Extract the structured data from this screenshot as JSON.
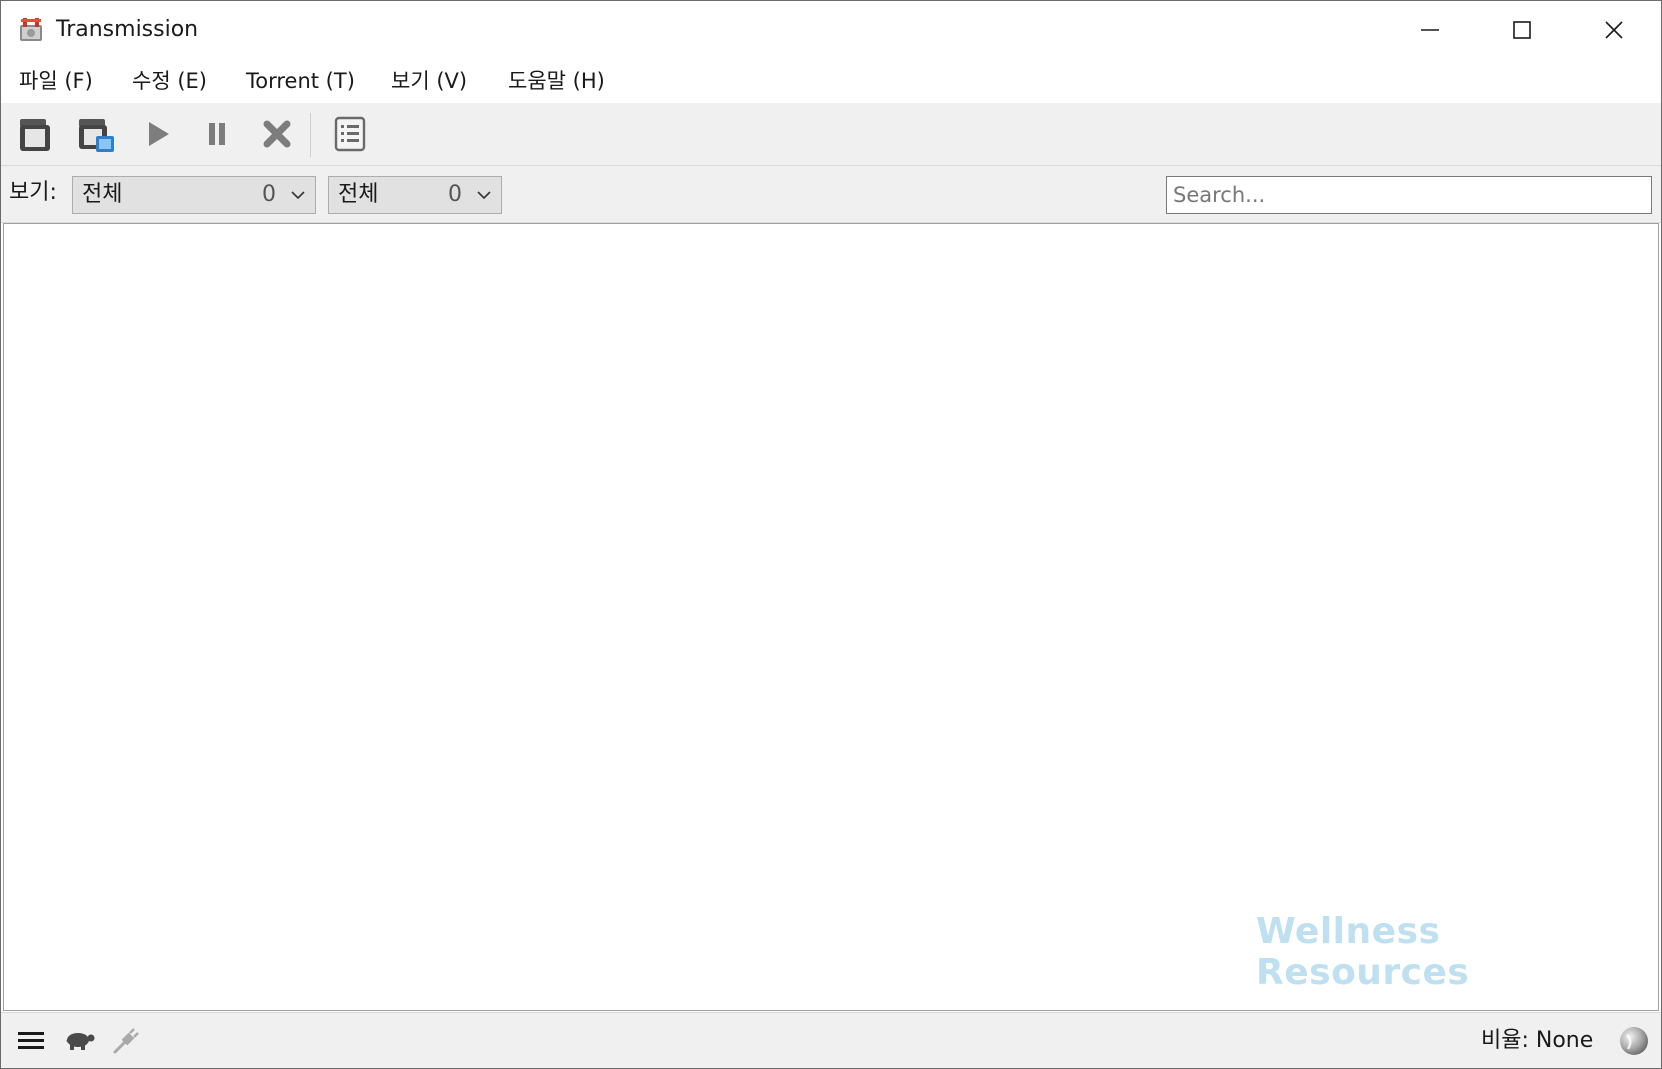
{
  "window": {
    "title": "Transmission"
  },
  "menu": {
    "items": [
      "파일 (F)",
      "수정 (E)",
      "Torrent (T)",
      "보기 (V)",
      "도움말 (H)"
    ]
  },
  "toolbar": {
    "buttons": [
      "open-torrent-icon",
      "open-url-icon",
      "start-icon",
      "pause-icon",
      "remove-icon",
      "properties-icon"
    ]
  },
  "filter": {
    "label": "보기:",
    "activity": {
      "value": "전체",
      "count": "0"
    },
    "tracker": {
      "value": "전체",
      "count": "0"
    },
    "search_placeholder": "Search..."
  },
  "watermark": "Wellness Resources",
  "statusbar": {
    "ratio_text": "비율: None"
  },
  "colors": {
    "chrome_bg": "#f0f0f0",
    "list_bg": "#ffffff",
    "watermark": "#bfe0f0",
    "icon_gray": "#7d7d7d"
  }
}
